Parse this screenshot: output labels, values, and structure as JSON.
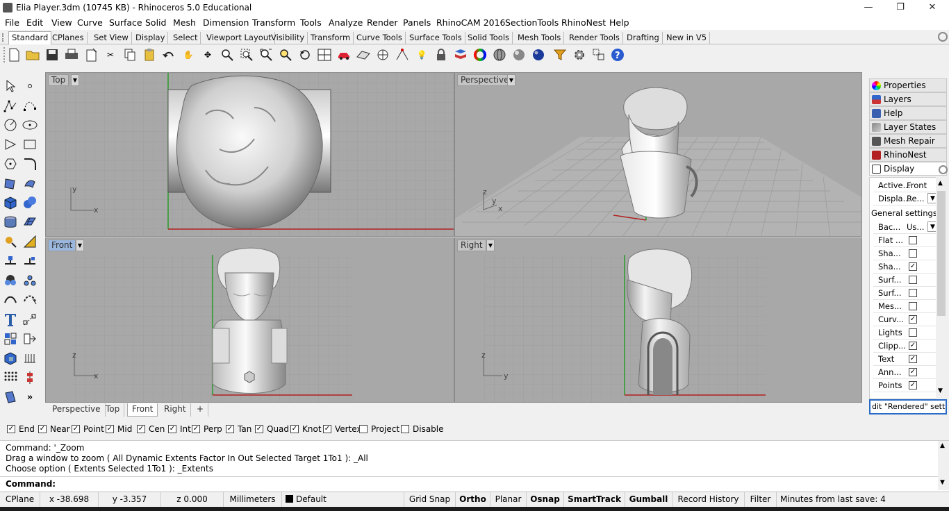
{
  "window": {
    "title": "Elia Player.3dm (10745 KB) - Rhinoceros 5.0 Educational",
    "minimize": "—",
    "restore": "❐",
    "close": "✕"
  },
  "menu": [
    "File",
    "Edit",
    "View",
    "Curve",
    "Surface",
    "Solid",
    "Mesh",
    "Dimension",
    "Transform",
    "Tools",
    "Analyze",
    "Render",
    "Panels",
    "RhinoCAM 2016",
    "SectionTools",
    "RhinoNest",
    "Help"
  ],
  "toolbar_tabs": [
    "Standard",
    "CPlanes",
    "Set View",
    "Display",
    "Select",
    "Viewport Layout",
    "Visibility",
    "Transform",
    "Curve Tools",
    "Surface Tools",
    "Solid Tools",
    "Mesh Tools",
    "Render Tools",
    "Drafting",
    "New in V5"
  ],
  "viewports": {
    "top": {
      "label": "Top",
      "axis1": "y",
      "axis2": "x"
    },
    "perspective": {
      "label": "Perspective",
      "axis1": "z",
      "axis2": "y",
      "axis3": "x"
    },
    "front": {
      "label": "Front",
      "axis1": "z",
      "axis2": "x"
    },
    "right": {
      "label": "Right",
      "axis1": "z",
      "axis2": "y"
    }
  },
  "viewport_tabs": [
    "Perspective",
    "Top",
    "Front",
    "Right"
  ],
  "viewport_tab_add": "+",
  "osnaps": [
    {
      "label": "End",
      "checked": true
    },
    {
      "label": "Near",
      "checked": true
    },
    {
      "label": "Point",
      "checked": true
    },
    {
      "label": "Mid",
      "checked": true
    },
    {
      "label": "Cen",
      "checked": true
    },
    {
      "label": "Int",
      "checked": true
    },
    {
      "label": "Perp",
      "checked": true
    },
    {
      "label": "Tan",
      "checked": true
    },
    {
      "label": "Quad",
      "checked": true
    },
    {
      "label": "Knot",
      "checked": true
    },
    {
      "label": "Vertex",
      "checked": true
    },
    {
      "label": "Project",
      "checked": false
    },
    {
      "label": "Disable",
      "checked": false
    }
  ],
  "command": {
    "line1": "Command: '_Zoom",
    "line2": "Drag a window to zoom ( All  Dynamic  Extents  Factor  In  Out  Selected  Target  1To1 ): _All",
    "line3": "Choose option ( Extents  Selected  1To1 ): _Extents",
    "prompt": "Command:"
  },
  "status": {
    "cplane": "CPlane",
    "x": "x -38.698",
    "y": "y -3.357",
    "z": "z 0.000",
    "units": "Millimeters",
    "layer": "Default",
    "grid_snap": "Grid Snap",
    "ortho": "Ortho",
    "planar": "Planar",
    "osnap": "Osnap",
    "smarttrack": "SmartTrack",
    "gumball": "Gumball",
    "record_history": "Record History",
    "filter": "Filter",
    "autosave": "Minutes from last save: 4"
  },
  "panel": {
    "tabs": [
      "Properties",
      "Layers",
      "Help",
      "Layer States",
      "Mesh Repair",
      "RhinoNest",
      "Display"
    ],
    "tab_colors": [
      "#d83b2b",
      "#c0392b",
      "#3a5fb0",
      "#6a5a8a",
      "#444",
      "#b22222",
      "#444"
    ],
    "active_key": "Active...",
    "active_val": "Front",
    "mode_key": "Displa...",
    "mode_val": "Re...",
    "section": "General settings",
    "bg_key": "Bac...",
    "bg_val": "Us...",
    "rows": [
      {
        "label": "Flat ...",
        "checked": false
      },
      {
        "label": "Sha...",
        "checked": false
      },
      {
        "label": "Sha...",
        "checked": true
      },
      {
        "label": "Surf...",
        "checked": false
      },
      {
        "label": "Surf...",
        "checked": false
      },
      {
        "label": "Mes...",
        "checked": false
      },
      {
        "label": "Curv...",
        "checked": true
      },
      {
        "label": "Lights",
        "checked": false
      },
      {
        "label": "Clipp...",
        "checked": true
      },
      {
        "label": "Text",
        "checked": true
      },
      {
        "label": "Ann...",
        "checked": true
      },
      {
        "label": "Points",
        "checked": true
      }
    ],
    "edit_button": "dit \"Rendered\" settings"
  }
}
